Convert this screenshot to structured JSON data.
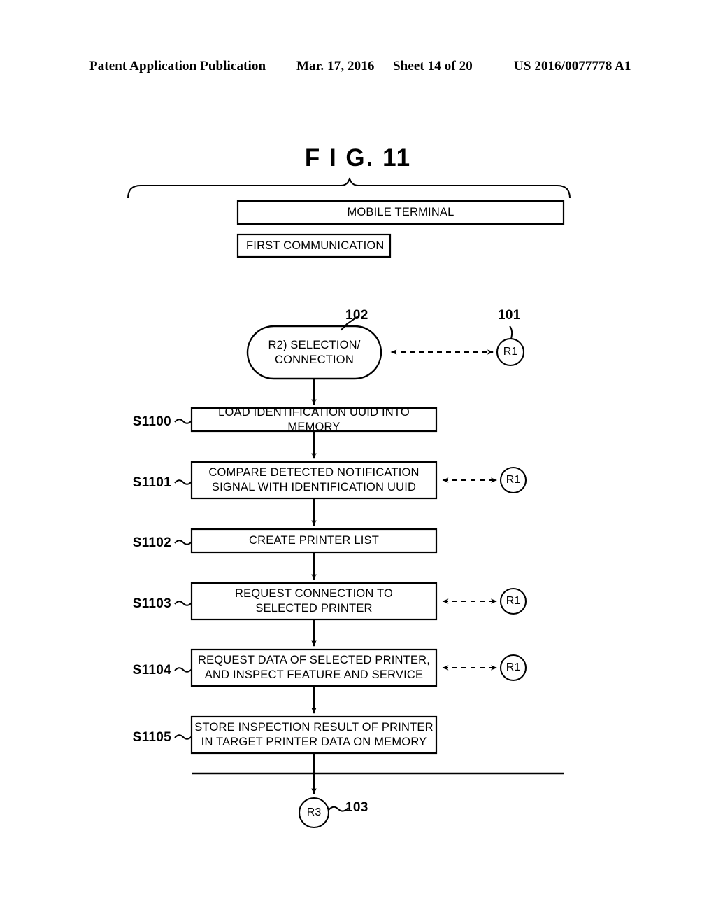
{
  "header": {
    "publication": "Patent Application Publication",
    "date": "Mar. 17, 2016",
    "sheet": "Sheet 14 of 20",
    "patent_number": "US 2016/0077778 A1"
  },
  "figure": {
    "title": "F I G.  11",
    "system_label": "MOBILE TERMINAL",
    "subsystem_label": "FIRST COMMUNICATION",
    "start_node": {
      "text": "R2) SELECTION/\nCONNECTION",
      "ref": "102"
    },
    "peer_node": {
      "text": "R1",
      "ref": "101"
    },
    "end_node": {
      "text": "R3",
      "ref": "103"
    },
    "steps": [
      {
        "id": "S1100",
        "text": "LOAD IDENTIFICATION UUID INTO MEMORY",
        "peer": null
      },
      {
        "id": "S1101",
        "text": "COMPARE DETECTED NOTIFICATION\nSIGNAL WITH IDENTIFICATION UUID",
        "peer": "R1"
      },
      {
        "id": "S1102",
        "text": "CREATE PRINTER LIST",
        "peer": null
      },
      {
        "id": "S1103",
        "text": "REQUEST CONNECTION TO\nSELECTED PRINTER",
        "peer": "R1"
      },
      {
        "id": "S1104",
        "text": "REQUEST DATA OF SELECTED PRINTER,\nAND INSPECT FEATURE AND SERVICE",
        "peer": "R1"
      },
      {
        "id": "S1105",
        "text": "STORE INSPECTION RESULT OF PRINTER\nIN TARGET PRINTER DATA ON MEMORY",
        "peer": null
      }
    ],
    "colors": {
      "ink": "#000000",
      "paper": "#ffffff"
    }
  }
}
